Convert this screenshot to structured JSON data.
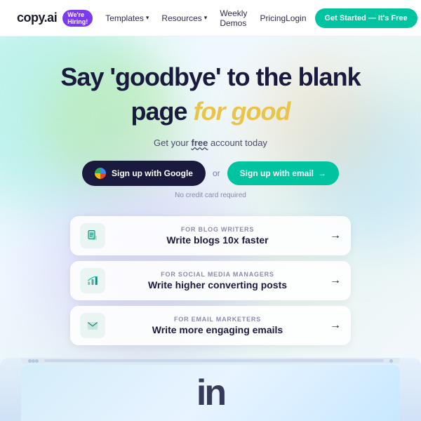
{
  "nav": {
    "logo": "copy.ai",
    "badge": "We're Hiring!",
    "links": [
      {
        "label": "Templates",
        "hasDropdown": true
      },
      {
        "label": "Resources",
        "hasDropdown": true
      },
      {
        "label": "Weekly Demos",
        "hasDropdown": false
      },
      {
        "label": "Pricing",
        "hasDropdown": false
      }
    ],
    "login": "Login",
    "cta": "Get Started — It's Free"
  },
  "hero": {
    "title_line1": "Say 'goodbye' to the blank",
    "title_line2_start": "page ",
    "title_line2_highlight": "for good",
    "subtitle": "Get your free account today",
    "subtitle_free": "free",
    "btn_google": "Sign up with Google",
    "btn_email": "Sign up with email",
    "or": "or",
    "no_cc": "No credit card required",
    "features": [
      {
        "label": "FOR BLOG WRITERS",
        "title": "Write blogs 10x faster",
        "icon": "document"
      },
      {
        "label": "FOR SOCIAL MEDIA MANAGERS",
        "title": "Write higher converting posts",
        "icon": "chart"
      },
      {
        "label": "FOR EMAIL MARKETERS",
        "title": "Write more engaging emails",
        "icon": "mail"
      }
    ],
    "preview_text": "in"
  }
}
